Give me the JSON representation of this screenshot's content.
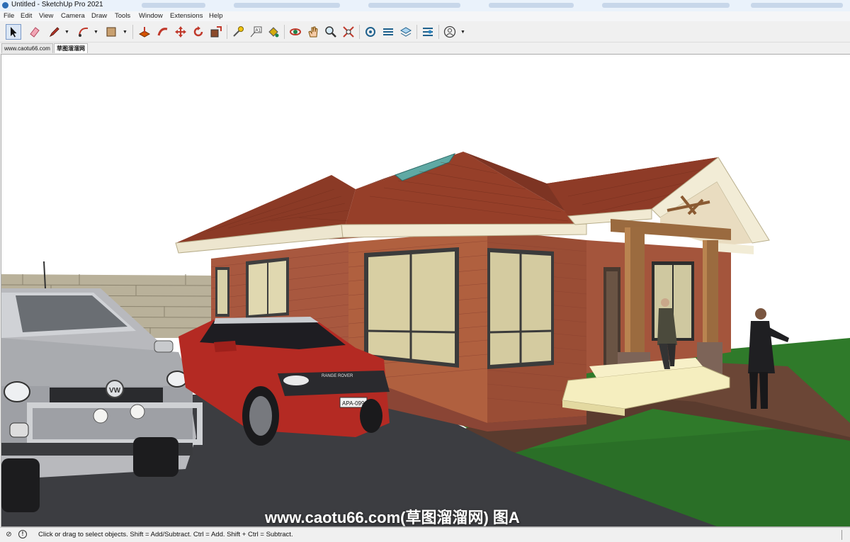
{
  "window": {
    "title": "Untitled - SketchUp Pro 2021"
  },
  "menu": [
    "File",
    "Edit",
    "View",
    "Camera",
    "Draw",
    "Tools",
    "Window",
    "Extensions",
    "Help"
  ],
  "toolbar": {
    "tools": [
      "select-tool",
      "eraser-tool",
      "line-tool",
      "arc-tool",
      "shape-tool",
      "push-pull-tool",
      "follow-me-tool",
      "move-tool",
      "rotate-tool",
      "scale-tool",
      "tape-measure-tool",
      "text-tool",
      "paint-bucket-tool",
      "orbit-tool",
      "pan-tool",
      "zoom-tool",
      "zoom-extents-tool",
      "3d-warehouse-tool",
      "extension-warehouse-tool",
      "layout-tool",
      "extension-manager-tool",
      "account-tool"
    ]
  },
  "tabs": [
    "www.caotu66.com",
    "草图溜溜网"
  ],
  "viewport": {
    "watermark": "www.caotu66.com(草图溜溜网) 图A",
    "plate": "APA-0991",
    "car_brand": "RANGE ROVER"
  },
  "status": {
    "text": "Click or drag to select objects. Shift = Add/Subtract. Ctrl = Add. Shift + Ctrl = Subtract."
  },
  "colors": {
    "accent": "#2d6db5",
    "roof": "#8b3a26",
    "brick": "#a8583f",
    "grass": "#2f7a2a",
    "asphalt": "#3c3d41"
  }
}
